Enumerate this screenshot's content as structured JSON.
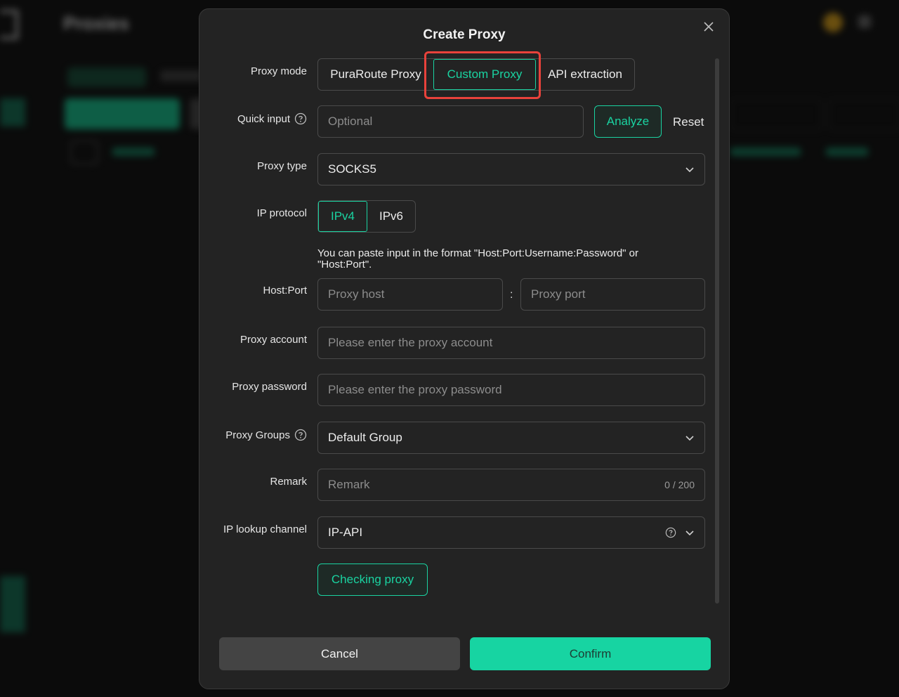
{
  "background": {
    "title": "Proxies"
  },
  "modal": {
    "title": "Create Proxy",
    "proxy_mode": {
      "label": "Proxy mode",
      "options": [
        "PuraRoute Proxy",
        "Custom Proxy",
        "API extraction"
      ],
      "selected": "Custom Proxy"
    },
    "quick_input": {
      "label": "Quick input",
      "placeholder": "Optional",
      "analyze_label": "Analyze",
      "reset_label": "Reset"
    },
    "proxy_type": {
      "label": "Proxy type",
      "value": "SOCKS5"
    },
    "ip_protocol": {
      "label": "IP protocol",
      "options": [
        "IPv4",
        "IPv6"
      ],
      "selected": "IPv4"
    },
    "hint": "You can paste input in the format \"Host:Port:Username:Password\" or \"Host:Port\".",
    "host_port": {
      "label": "Host:Port",
      "host_placeholder": "Proxy host",
      "separator": ":",
      "port_placeholder": "Proxy port"
    },
    "proxy_account": {
      "label": "Proxy account",
      "placeholder": "Please enter the proxy account"
    },
    "proxy_password": {
      "label": "Proxy password",
      "placeholder": "Please enter the proxy password"
    },
    "proxy_groups": {
      "label": "Proxy Groups",
      "value": "Default Group"
    },
    "remark": {
      "label": "Remark",
      "placeholder": "Remark",
      "counter": "0 / 200"
    },
    "ip_lookup": {
      "label": "IP lookup channel",
      "value": "IP-API"
    },
    "checking_label": "Checking proxy",
    "cancel_label": "Cancel",
    "confirm_label": "Confirm"
  },
  "colors": {
    "accent": "#1ad3a1",
    "highlight": "#e8423b",
    "modal_bg": "#232323"
  }
}
